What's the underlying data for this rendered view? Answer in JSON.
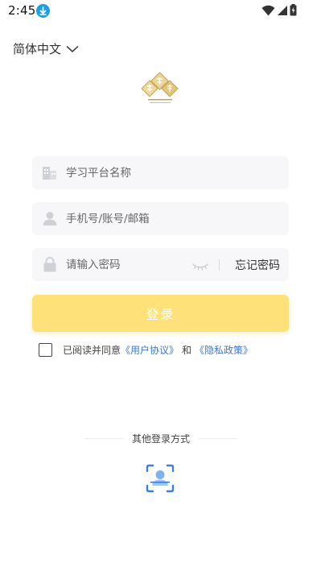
{
  "status_bar": {
    "time": "2:45",
    "icons": [
      "download-icon",
      "wifi-icon",
      "cellular-signal-icon",
      "battery-charging-icon"
    ]
  },
  "language": {
    "selected": "简体中文",
    "icon": "chevron-down-icon"
  },
  "form": {
    "school": {
      "placeholder": "学习平台名称",
      "value": "",
      "icon": "building-icon"
    },
    "account": {
      "placeholder": "手机号/账号/邮箱",
      "value": "",
      "icon": "person-icon"
    },
    "password": {
      "placeholder": "请输入密码",
      "value": "",
      "icon": "lock-icon",
      "toggle_icon": "eye-closed-icon",
      "forgot_label": "忘记密码"
    },
    "login_label": "登录"
  },
  "agreement": {
    "prefix": "已阅读并同意",
    "user_agreement": "《用户协议》",
    "and": "和",
    "privacy_policy": "《隐私政策》",
    "checked": false
  },
  "other_login": {
    "label": "其他登录方式",
    "face_icon": "face-scan-icon"
  },
  "colors": {
    "accent": "#ffe17a",
    "link": "#3a78d6",
    "field_bg": "#f7f7f9",
    "logo_gold": "#c9a24a"
  }
}
